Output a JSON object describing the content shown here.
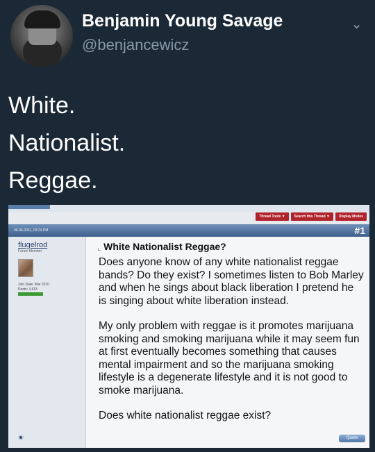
{
  "author": {
    "display_name": "Benjamin Young Savage",
    "handle": "@benjancewicz"
  },
  "menu_icon": "chevron-down-icon",
  "tweet": {
    "lines": [
      "White.",
      "Nationalist.",
      "Reggae."
    ]
  },
  "forum": {
    "toolbar": {
      "thread_tools": "Thread Tools ▼",
      "search_thread": "Search this Thread ▼",
      "display_modes": "Display Modes"
    },
    "post_date": "06-04-2011, 03:24 PM",
    "post_number": "#1",
    "user": {
      "name": "flugelrod",
      "title": "Forum Member",
      "join_date": "Join Date: Mar 2010",
      "posts": "Posts: 3,533"
    },
    "post_title": "White Nationalist Reggae?",
    "post_paragraphs": [
      "Does anyone know of any white nationalist reggae bands? Do they exist? I sometimes listen to Bob Marley and when he sings about black liberation I pretend he is singing about white liberation instead.",
      "My only problem with reggae is it promotes marijuana smoking and smoking marijuana while it may seem fun at first eventually becomes something that causes mental impairment and so the marijuana smoking lifestyle is a degenerate lifestyle and it is not good to smoke marijuana.",
      "Does white nationalist reggae exist?"
    ],
    "quote_label": "Quote"
  }
}
